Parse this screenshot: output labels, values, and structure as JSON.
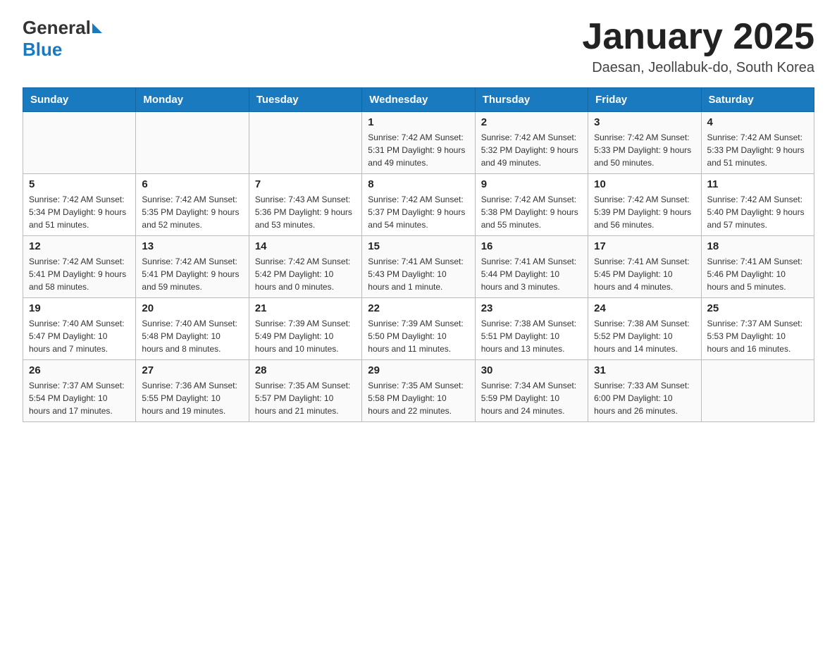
{
  "logo": {
    "general": "General",
    "blue": "Blue"
  },
  "title": "January 2025",
  "subtitle": "Daesan, Jeollabuk-do, South Korea",
  "weekdays": [
    "Sunday",
    "Monday",
    "Tuesday",
    "Wednesday",
    "Thursday",
    "Friday",
    "Saturday"
  ],
  "weeks": [
    [
      {
        "day": "",
        "info": ""
      },
      {
        "day": "",
        "info": ""
      },
      {
        "day": "",
        "info": ""
      },
      {
        "day": "1",
        "info": "Sunrise: 7:42 AM\nSunset: 5:31 PM\nDaylight: 9 hours\nand 49 minutes."
      },
      {
        "day": "2",
        "info": "Sunrise: 7:42 AM\nSunset: 5:32 PM\nDaylight: 9 hours\nand 49 minutes."
      },
      {
        "day": "3",
        "info": "Sunrise: 7:42 AM\nSunset: 5:33 PM\nDaylight: 9 hours\nand 50 minutes."
      },
      {
        "day": "4",
        "info": "Sunrise: 7:42 AM\nSunset: 5:33 PM\nDaylight: 9 hours\nand 51 minutes."
      }
    ],
    [
      {
        "day": "5",
        "info": "Sunrise: 7:42 AM\nSunset: 5:34 PM\nDaylight: 9 hours\nand 51 minutes."
      },
      {
        "day": "6",
        "info": "Sunrise: 7:42 AM\nSunset: 5:35 PM\nDaylight: 9 hours\nand 52 minutes."
      },
      {
        "day": "7",
        "info": "Sunrise: 7:43 AM\nSunset: 5:36 PM\nDaylight: 9 hours\nand 53 minutes."
      },
      {
        "day": "8",
        "info": "Sunrise: 7:42 AM\nSunset: 5:37 PM\nDaylight: 9 hours\nand 54 minutes."
      },
      {
        "day": "9",
        "info": "Sunrise: 7:42 AM\nSunset: 5:38 PM\nDaylight: 9 hours\nand 55 minutes."
      },
      {
        "day": "10",
        "info": "Sunrise: 7:42 AM\nSunset: 5:39 PM\nDaylight: 9 hours\nand 56 minutes."
      },
      {
        "day": "11",
        "info": "Sunrise: 7:42 AM\nSunset: 5:40 PM\nDaylight: 9 hours\nand 57 minutes."
      }
    ],
    [
      {
        "day": "12",
        "info": "Sunrise: 7:42 AM\nSunset: 5:41 PM\nDaylight: 9 hours\nand 58 minutes."
      },
      {
        "day": "13",
        "info": "Sunrise: 7:42 AM\nSunset: 5:41 PM\nDaylight: 9 hours\nand 59 minutes."
      },
      {
        "day": "14",
        "info": "Sunrise: 7:42 AM\nSunset: 5:42 PM\nDaylight: 10 hours\nand 0 minutes."
      },
      {
        "day": "15",
        "info": "Sunrise: 7:41 AM\nSunset: 5:43 PM\nDaylight: 10 hours\nand 1 minute."
      },
      {
        "day": "16",
        "info": "Sunrise: 7:41 AM\nSunset: 5:44 PM\nDaylight: 10 hours\nand 3 minutes."
      },
      {
        "day": "17",
        "info": "Sunrise: 7:41 AM\nSunset: 5:45 PM\nDaylight: 10 hours\nand 4 minutes."
      },
      {
        "day": "18",
        "info": "Sunrise: 7:41 AM\nSunset: 5:46 PM\nDaylight: 10 hours\nand 5 minutes."
      }
    ],
    [
      {
        "day": "19",
        "info": "Sunrise: 7:40 AM\nSunset: 5:47 PM\nDaylight: 10 hours\nand 7 minutes."
      },
      {
        "day": "20",
        "info": "Sunrise: 7:40 AM\nSunset: 5:48 PM\nDaylight: 10 hours\nand 8 minutes."
      },
      {
        "day": "21",
        "info": "Sunrise: 7:39 AM\nSunset: 5:49 PM\nDaylight: 10 hours\nand 10 minutes."
      },
      {
        "day": "22",
        "info": "Sunrise: 7:39 AM\nSunset: 5:50 PM\nDaylight: 10 hours\nand 11 minutes."
      },
      {
        "day": "23",
        "info": "Sunrise: 7:38 AM\nSunset: 5:51 PM\nDaylight: 10 hours\nand 13 minutes."
      },
      {
        "day": "24",
        "info": "Sunrise: 7:38 AM\nSunset: 5:52 PM\nDaylight: 10 hours\nand 14 minutes."
      },
      {
        "day": "25",
        "info": "Sunrise: 7:37 AM\nSunset: 5:53 PM\nDaylight: 10 hours\nand 16 minutes."
      }
    ],
    [
      {
        "day": "26",
        "info": "Sunrise: 7:37 AM\nSunset: 5:54 PM\nDaylight: 10 hours\nand 17 minutes."
      },
      {
        "day": "27",
        "info": "Sunrise: 7:36 AM\nSunset: 5:55 PM\nDaylight: 10 hours\nand 19 minutes."
      },
      {
        "day": "28",
        "info": "Sunrise: 7:35 AM\nSunset: 5:57 PM\nDaylight: 10 hours\nand 21 minutes."
      },
      {
        "day": "29",
        "info": "Sunrise: 7:35 AM\nSunset: 5:58 PM\nDaylight: 10 hours\nand 22 minutes."
      },
      {
        "day": "30",
        "info": "Sunrise: 7:34 AM\nSunset: 5:59 PM\nDaylight: 10 hours\nand 24 minutes."
      },
      {
        "day": "31",
        "info": "Sunrise: 7:33 AM\nSunset: 6:00 PM\nDaylight: 10 hours\nand 26 minutes."
      },
      {
        "day": "",
        "info": ""
      }
    ]
  ]
}
